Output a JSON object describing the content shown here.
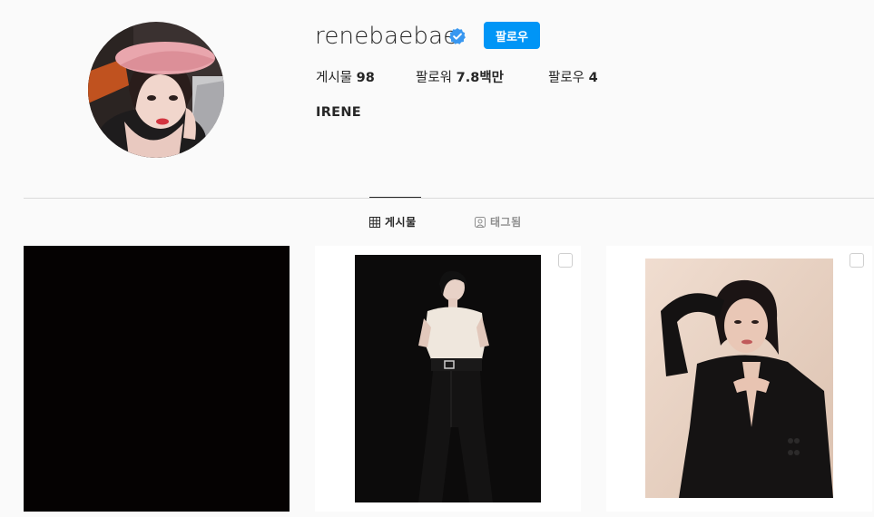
{
  "profile": {
    "username": "renebaebae",
    "verified": true,
    "follow_label": "팔로우",
    "full_name": "IRENE"
  },
  "stats": [
    {
      "label": "게시물",
      "value": "98"
    },
    {
      "label": "팔로워",
      "value": "7.8백만"
    },
    {
      "label": "팔로우",
      "value": "4"
    }
  ],
  "tabs": [
    {
      "label": "게시물",
      "icon": "grid-icon",
      "active": true
    },
    {
      "label": "태그됨",
      "icon": "tag-icon",
      "active": false
    }
  ],
  "colors": {
    "accent": "#0095f6",
    "background": "#fafafa",
    "divider": "#dbdbdb",
    "text": "#262626",
    "muted": "#8e8e8e"
  }
}
